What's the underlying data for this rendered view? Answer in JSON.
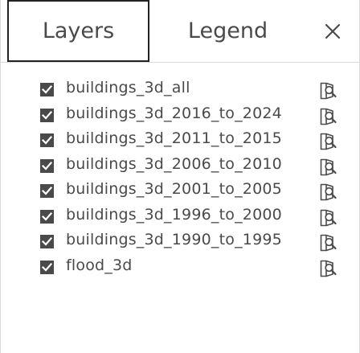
{
  "tabs": {
    "layers_label": "Layers",
    "legend_label": "Legend"
  },
  "icons": {
    "close": "close-icon",
    "checkbox": "checkbox-checked-icon",
    "zoom": "zoom-to-layer-icon"
  },
  "layers": [
    {
      "name": "buildings_3d_all",
      "checked": true
    },
    {
      "name": "buildings_3d_2016_to_2024",
      "checked": true
    },
    {
      "name": "buildings_3d_2011_to_2015",
      "checked": true
    },
    {
      "name": "buildings_3d_2006_to_2010",
      "checked": true
    },
    {
      "name": "buildings_3d_2001_to_2005",
      "checked": true
    },
    {
      "name": "buildings_3d_1996_to_2000",
      "checked": true
    },
    {
      "name": "buildings_3d_1990_to_1995",
      "checked": true
    },
    {
      "name": "flood_3d",
      "checked": true
    }
  ],
  "colors": {
    "text": "#4a4a4a",
    "active_tab_border": "#222222",
    "divider": "#d9d9d9"
  }
}
